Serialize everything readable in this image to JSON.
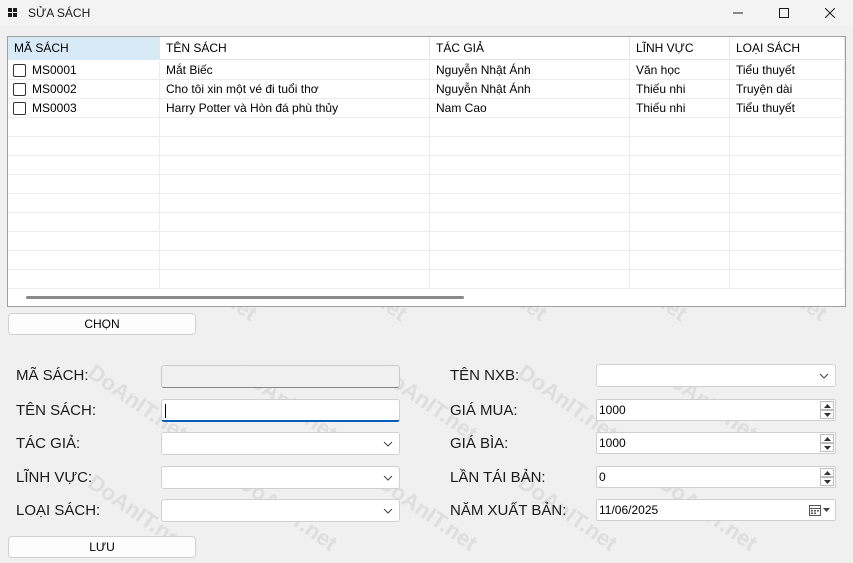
{
  "window": {
    "title": "SỬA SÁCH",
    "icons": {
      "app": "app-grid-icon",
      "minimize": "minimize-icon",
      "maximize": "maximize-icon",
      "close": "close-icon"
    }
  },
  "grid": {
    "columns": [
      "MÃ SÁCH",
      "TÊN SÁCH",
      "TÁC GIẢ",
      "LĨNH VỰC",
      "LOẠI SÁCH"
    ],
    "rows": [
      [
        "MS0001",
        "Mắt Biếc",
        "Nguyễn Nhật Ánh",
        "Văn học",
        "Tiểu thuyết"
      ],
      [
        "MS0002",
        "Cho tôi xin một vé đi tuổi thơ",
        "Nguyễn Nhật Ánh",
        "Thiếu nhi",
        "Truyện dài"
      ],
      [
        "MS0003",
        "Harry Potter và Hòn đá phù thủy",
        "Nam Cao",
        "Thiếu nhi",
        "Tiểu thuyết"
      ]
    ]
  },
  "buttons": {
    "select": "CHỌN",
    "save": "LƯU"
  },
  "form": {
    "ma_sach_label": "MÃ SÁCH:",
    "ma_sach_value": "",
    "ten_sach_label": "TÊN SÁCH:",
    "ten_sach_value": "",
    "tac_gia_label": "TÁC GIẢ:",
    "tac_gia_value": "",
    "linh_vuc_label": "LĨNH VỰC:",
    "linh_vuc_value": "",
    "loai_sach_label": "LOẠI SÁCH:",
    "loai_sach_value": "",
    "ten_nxb_label": "TÊN NXB:",
    "ten_nxb_value": "",
    "gia_mua_label": "GIÁ MUA:",
    "gia_mua_value": "1000",
    "gia_bia_label": "GIÁ BÌA:",
    "gia_bia_value": "1000",
    "lan_tai_ban_label": "LẦN TÁI BẢN:",
    "lan_tai_ban_value": "0",
    "nam_xuat_ban_label": "NĂM XUẤT BẢN:",
    "nam_xuat_ban_value": "11/06/2025"
  },
  "watermark": "DoAnIT.net",
  "colors": {
    "header_selected": "#d9eaf7",
    "focus_accent": "#005fb8"
  }
}
